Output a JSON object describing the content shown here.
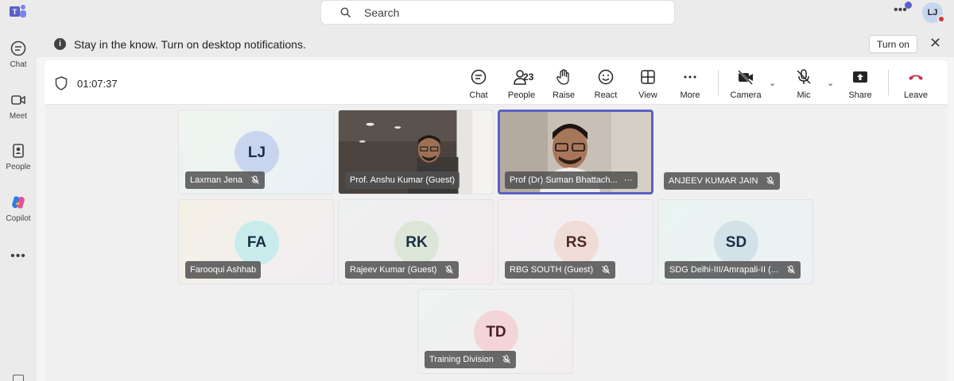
{
  "rail": {
    "items": [
      {
        "label": "Chat",
        "icon": "chat-icon"
      },
      {
        "label": "Meet",
        "icon": "video-camera-icon"
      },
      {
        "label": "People",
        "icon": "people-icon"
      },
      {
        "label": "Copilot",
        "icon": "copilot-icon"
      }
    ],
    "more": "•••"
  },
  "topbar": {
    "search_placeholder": "Search",
    "more": "•••",
    "avatar_initials": "LJ"
  },
  "notification": {
    "text": "Stay in the know. Turn on desktop notifications.",
    "button": "Turn on",
    "close": "✕"
  },
  "meeting": {
    "timer": "01:07:37",
    "people_count": "23",
    "toolbar": {
      "chat": "Chat",
      "people": "People",
      "raise": "Raise",
      "react": "React",
      "view": "View",
      "more": "More",
      "camera": "Camera",
      "mic": "Mic",
      "share": "Share",
      "leave": "Leave"
    },
    "participants": [
      {
        "name": "Laxman Jena",
        "initials": "LJ",
        "avatar_color": "#c9d5ee"
      },
      {
        "name": "Prof. Anshu Kumar (Guest)",
        "initials": ""
      },
      {
        "name": "Prof (Dr) Suman Bhattach...",
        "initials": "",
        "more": "···"
      },
      {
        "name": "ANJEEV KUMAR JAIN",
        "initials": ""
      },
      {
        "name": "Farooqui Ashhab",
        "initials": "FA",
        "avatar_color": "#c8ecec"
      },
      {
        "name": "Rajeev Kumar (Guest)",
        "initials": "RK",
        "avatar_color": "#dbe6d6"
      },
      {
        "name": "RBG SOUTH (Guest)",
        "initials": "RS",
        "avatar_color": "#f0dcd6"
      },
      {
        "name": "SDG Delhi-III/Amrapali-II (...",
        "initials": "SD",
        "avatar_color": "#d3e1e8"
      },
      {
        "name": "Training Division",
        "initials": "TD",
        "avatar_color": "#f3d4d7"
      }
    ]
  },
  "colors": {
    "accent": "#5b5fc7",
    "leave": "#c4314b",
    "status_busy": "#d13438"
  }
}
